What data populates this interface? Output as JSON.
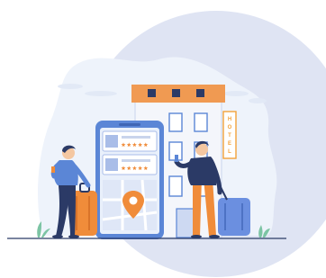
{
  "illustration": {
    "hotel_sign": [
      "H",
      "O",
      "T",
      "E",
      "L"
    ],
    "review_stars": 5,
    "colors": {
      "background_blob": "#dfe4f3",
      "scene_backdrop": "#eef3fb",
      "phone_frame": "#5b86d6",
      "phone_screen": "#e9f0fb",
      "hotel_roof": "#f09a52",
      "hotel_wall": "#f4f6fb",
      "accent_orange": "#f08c3a",
      "luggage_blue": "#6b8fe0",
      "jacket_navy": "#2b3a66"
    },
    "icons": [
      "location-pin-icon",
      "star-rating-icon"
    ]
  }
}
